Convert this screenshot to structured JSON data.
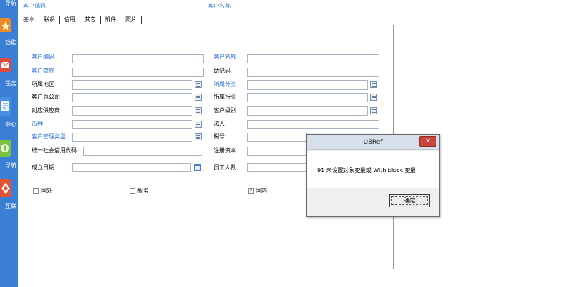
{
  "sidenav": {
    "items": [
      {
        "label": "导航",
        "icon": "nav-icon",
        "color": "#3a7fd5"
      },
      {
        "label": "功能",
        "icon": "star-icon",
        "color": "#f08a24"
      },
      {
        "label": "任务",
        "icon": "mail-icon",
        "color": "#e24b3b"
      },
      {
        "label": "中心",
        "icon": "document-icon",
        "color": "#4a90e2"
      },
      {
        "label": "导航",
        "icon": "compass-icon",
        "color": "#7cc242"
      },
      {
        "label": "互联",
        "icon": "diamond-icon",
        "color": "#e8502f"
      }
    ]
  },
  "header": {
    "customer_code_label": "客户编码",
    "customer_name_label": "客户名称"
  },
  "tabs": [
    "基本",
    "联系",
    "信用",
    "其它",
    "附件",
    "照片"
  ],
  "form": {
    "customer_code": {
      "label": "客户编码",
      "value": ""
    },
    "customer_name": {
      "label": "客户名称",
      "value": ""
    },
    "customer_abbr": {
      "label": "客户简称",
      "value": ""
    },
    "mnemonic_code": {
      "label": "助记码",
      "value": ""
    },
    "region": {
      "label": "所属地区",
      "value": ""
    },
    "category": {
      "label": "所属分类",
      "value": ""
    },
    "head_office": {
      "label": "客户总公司",
      "value": ""
    },
    "industry": {
      "label": "所属行业",
      "value": ""
    },
    "supplier": {
      "label": "对应供应商",
      "value": ""
    },
    "customer_level": {
      "label": "客户级别",
      "value": ""
    },
    "currency": {
      "label": "币种",
      "value": ""
    },
    "legal_person": {
      "label": "法人",
      "value": ""
    },
    "mgmt_type": {
      "label": "客户管理类型",
      "value": ""
    },
    "tax_no": {
      "label": "税号",
      "value": ""
    },
    "credit_code": {
      "label": "统一社会信用代码",
      "value": ""
    },
    "registered_capital": {
      "label": "注册资本",
      "value": ""
    },
    "established_date": {
      "label": "成立日期",
      "value": ""
    },
    "employee_count": {
      "label": "员工人数",
      "value": ""
    },
    "foreign": {
      "label": "国外",
      "checked": false
    },
    "service": {
      "label": "服务",
      "checked": false
    },
    "domestic": {
      "label": "国内",
      "checked": true
    }
  },
  "dialog": {
    "title": "U8Ref",
    "message": "91 未设置对象变量或 With block 变量",
    "ok_label": "确定",
    "close_label": "✕"
  }
}
